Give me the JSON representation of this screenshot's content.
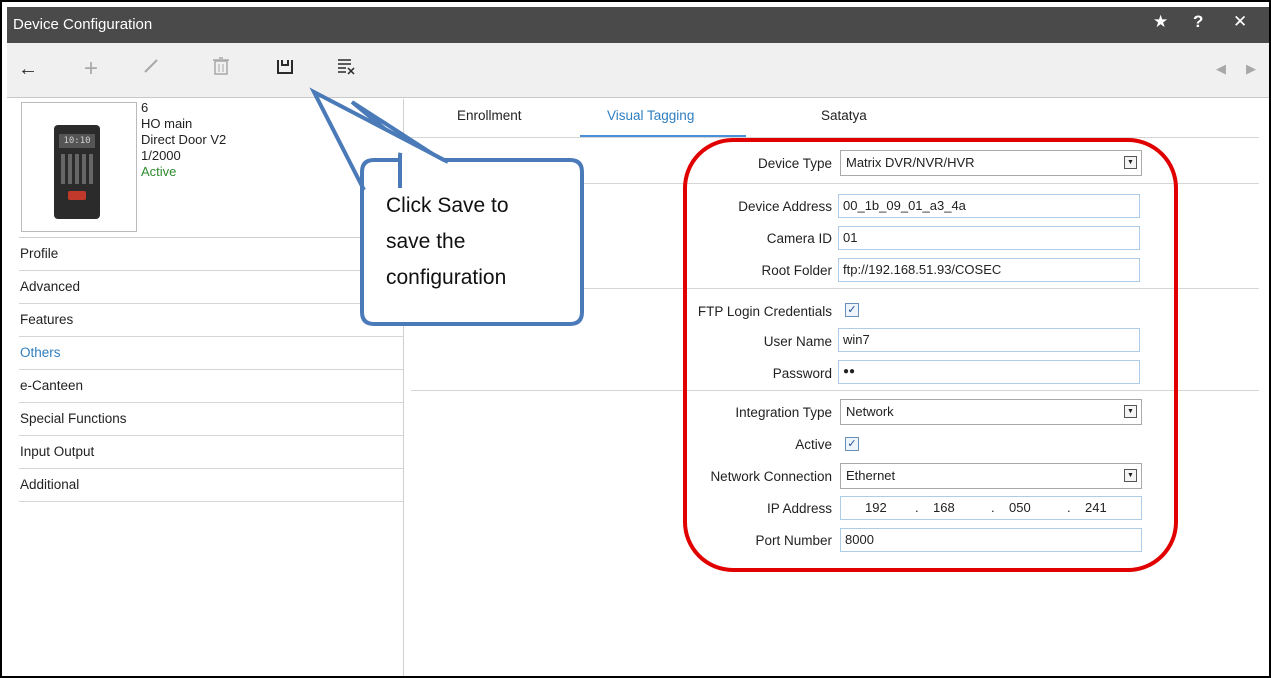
{
  "window": {
    "title": "Device Configuration",
    "buttons": {
      "star": "★",
      "help": "?",
      "close": "✕"
    }
  },
  "toolbar": {
    "back": "←",
    "add": "+",
    "edit": "∕",
    "delete": "🗑",
    "save": "💾",
    "clear": "☷"
  },
  "device": {
    "id": "6",
    "name": "HO main",
    "model": "Direct Door V2",
    "number": "1/2000",
    "status": "Active",
    "screen_text": "10:10"
  },
  "sidebar": {
    "items": [
      {
        "label": "Profile"
      },
      {
        "label": "Advanced"
      },
      {
        "label": "Features"
      },
      {
        "label": "Others"
      },
      {
        "label": "e-Canteen"
      },
      {
        "label": "Special Functions"
      },
      {
        "label": "Input Output"
      },
      {
        "label": "Additional"
      }
    ]
  },
  "tabs": [
    {
      "label": "Enrollment"
    },
    {
      "label": "Visual Tagging"
    },
    {
      "label": "Satatya"
    }
  ],
  "form": {
    "device_type": {
      "label": "Device Type",
      "value": "Matrix DVR/NVR/HVR"
    },
    "device_address": {
      "label": "Device Address",
      "value": "00_1b_09_01_a3_4a"
    },
    "camera_id": {
      "label": "Camera ID",
      "value": "01"
    },
    "root_folder": {
      "label": "Root Folder",
      "value": "ftp://192.168.51.93/COSEC"
    },
    "ftp_login": {
      "label": "FTP Login Credentials",
      "checked": true,
      "mark": "✓"
    },
    "user_name": {
      "label": "User Name",
      "value": "win7"
    },
    "password": {
      "label": "Password",
      "value": "●●"
    },
    "integration_type": {
      "label": "Integration Type",
      "value": "Network"
    },
    "active": {
      "label": "Active",
      "checked": true,
      "mark": "✓"
    },
    "network_connection": {
      "label": "Network Connection",
      "value": "Ethernet"
    },
    "ip_address": {
      "label": "IP Address",
      "octets": [
        "192",
        "168",
        "050",
        "241"
      ],
      "dot": "."
    },
    "port_number": {
      "label": "Port Number",
      "value": "8000"
    }
  },
  "annotation": {
    "callout_text": "Click Save to save the configuration",
    "callout_color": "#4a7ab8",
    "highlight_color": "#e00000"
  },
  "colors": {
    "titlebar": "#4a4a4a",
    "accent": "#2f7fc1",
    "status_active": "#2e8b2e"
  }
}
